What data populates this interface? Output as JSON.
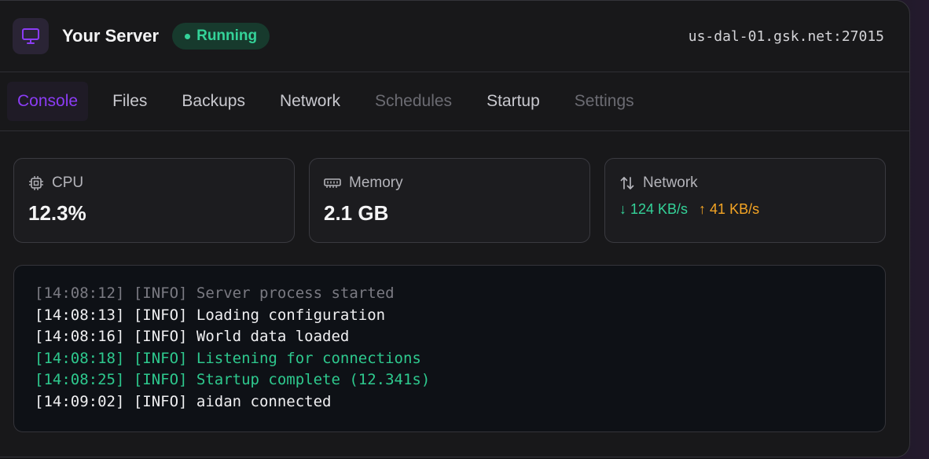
{
  "header": {
    "title": "Your Server",
    "status": "Running",
    "address": "us-dal-01.gsk.net:27015",
    "icon": "monitor-icon"
  },
  "tabs": [
    {
      "label": "Console",
      "state": "active"
    },
    {
      "label": "Files",
      "state": "normal"
    },
    {
      "label": "Backups",
      "state": "normal"
    },
    {
      "label": "Network",
      "state": "normal"
    },
    {
      "label": "Schedules",
      "state": "disabled"
    },
    {
      "label": "Startup",
      "state": "normal"
    },
    {
      "label": "Settings",
      "state": "disabled"
    }
  ],
  "stats": {
    "cpu": {
      "label": "CPU",
      "value": "12.3%",
      "icon": "cpu-icon"
    },
    "memory": {
      "label": "Memory",
      "value": "2.1 GB",
      "icon": "memory-icon"
    },
    "network": {
      "label": "Network",
      "down": "↓ 124 KB/s",
      "up": "↑ 41 KB/s",
      "icon": "arrows-up-down-icon"
    }
  },
  "console": {
    "lines": [
      {
        "text": "[14:08:12] [INFO] Server process started",
        "style": "dim"
      },
      {
        "text": "[14:08:13] [INFO] Loading configuration",
        "style": "normal"
      },
      {
        "text": "[14:08:16] [INFO] World data loaded",
        "style": "normal"
      },
      {
        "text": "[14:08:18] [INFO] Listening for connections",
        "style": "green"
      },
      {
        "text": "[14:08:25] [INFO] Startup complete (12.341s)",
        "style": "green"
      },
      {
        "text": "[14:09:02] [INFO] aidan connected",
        "style": "normal"
      }
    ]
  },
  "colors": {
    "accent": "#8b3cf5",
    "success": "#34d399",
    "warning": "#f5a524"
  }
}
